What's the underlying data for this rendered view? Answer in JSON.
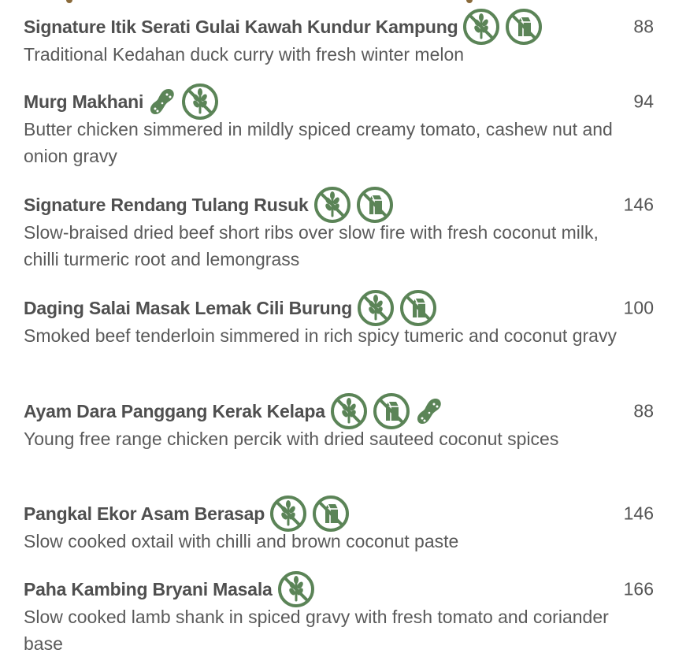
{
  "colors": {
    "icon_green": "#5b8457",
    "text": "#555555",
    "title": "#4f4f4f"
  },
  "items": [
    {
      "name": "Signature Itik Serati Gulai Kawah Kundur Kampung",
      "description": "Traditional Kedahan duck curry with fresh winter melon",
      "price": "88",
      "icons": [
        "gluten-free-icon",
        "dairy-free-icon"
      ]
    },
    {
      "name": "Murg Makhani",
      "description": "Butter chicken simmered in mildly spiced creamy tomato, cashew nut and onion gravy",
      "price": "94",
      "icons": [
        "contains-nuts-icon",
        "gluten-free-icon"
      ]
    },
    {
      "name": "Signature Rendang Tulang Rusuk",
      "description": "Slow-braised dried beef short ribs over slow fire with fresh coconut milk, chilli turmeric root and lemongrass",
      "price": "146",
      "icons": [
        "gluten-free-icon",
        "dairy-free-icon"
      ]
    },
    {
      "name": "Daging Salai Masak Lemak Cili Burung",
      "description": "Smoked beef tenderloin simmered in rich spicy tumeric and coconut gravy",
      "price": "100",
      "icons": [
        "gluten-free-icon",
        "dairy-free-icon"
      ]
    },
    {
      "name": "Ayam Dara Panggang Kerak Kelapa",
      "description": "Young free range chicken percik with dried sauteed coconut spices",
      "price": "88",
      "icons": [
        "gluten-free-icon",
        "dairy-free-icon",
        "contains-nuts-icon"
      ]
    },
    {
      "name": "Pangkal Ekor Asam Berasap",
      "description": "Slow cooked oxtail with chilli and brown coconut paste",
      "price": "146",
      "icons": [
        "gluten-free-icon",
        "dairy-free-icon"
      ]
    },
    {
      "name": "Paha Kambing Bryani Masala",
      "description": "Slow cooked lamb shank in spiced gravy with fresh tomato and coriander base",
      "price": "166",
      "icons": [
        "gluten-free-icon"
      ]
    }
  ]
}
